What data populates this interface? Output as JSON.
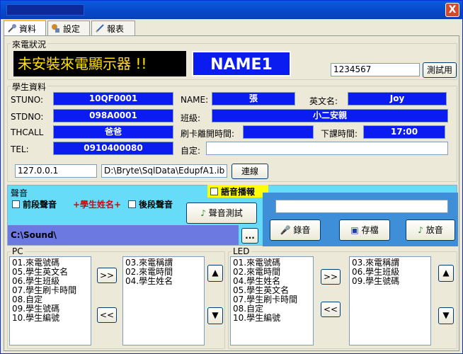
{
  "tabs": [
    {
      "label": "資料",
      "icon": "wrench-icon"
    },
    {
      "label": "設定",
      "icon": "settings-icon"
    },
    {
      "label": "報表",
      "icon": "report-icon"
    }
  ],
  "close_label": "X",
  "caller": {
    "group_label": "來電狀況",
    "status": "未安裝來電顯示器 !!",
    "name": "NAME1",
    "test_value": "1234567",
    "test_button": "測試用"
  },
  "student": {
    "group_label": "學生資料",
    "stuno_label": "STUNO:",
    "stuno": "10QF0001",
    "stdno_label": "STDNO:",
    "stdno": "098A0001",
    "thcall_label": "THCALL",
    "thcall": "爸爸",
    "tel_label": "TEL:",
    "tel": "0910400080",
    "name_label": "NAME:",
    "name": "張",
    "eng_label": "英文名:",
    "eng": "Joy",
    "class_label": "班級:",
    "class": "小二安親",
    "card_label": "刷卡離開時間:",
    "card": "",
    "dismiss_label": "下課時間:",
    "dismiss": "17:00",
    "custom_label": "自定:",
    "custom": "",
    "ip": "127.0.0.1",
    "db": "D:\\Bryte\\SqlData\\EdupfA1.ib",
    "connect_button": "連線"
  },
  "sound": {
    "group_label": "聲音",
    "pre_label": "前段聲音",
    "name_tag": "+學生姓名+",
    "post_label": "後段聲音",
    "test_button": "聲音測試",
    "path": "C:\\Sound\\",
    "browse_button": "...",
    "tts_label": "語音播報",
    "tts_text": "",
    "record_button": "錄音",
    "save_button": "存檔",
    "play_button": "放音"
  },
  "pc": {
    "group_label": "PC",
    "available": [
      "01.來電號碼",
      "05.學生英文名",
      "06.學生班級",
      "07.學生刷卡時間",
      "08.自定",
      "09.學生號碼",
      "10.學生編號"
    ],
    "selected": [
      "03.來電稱謂",
      "02.來電時間",
      "04.學生姓名"
    ],
    "add": ">>",
    "remove": "<<",
    "up": "▲",
    "down": "▼"
  },
  "led": {
    "group_label": "LED",
    "available": [
      "01.來電號碼",
      "02.來電時間",
      "04.學生姓名",
      "05.學生英文名",
      "07.學生刷卡時間",
      "08.自定",
      "10.學生編號"
    ],
    "selected": [
      "03.來電稱謂",
      "06.學生班級",
      "09.學生號碼"
    ],
    "add": ">>",
    "remove": "<<",
    "up": "▲",
    "down": "▼"
  }
}
